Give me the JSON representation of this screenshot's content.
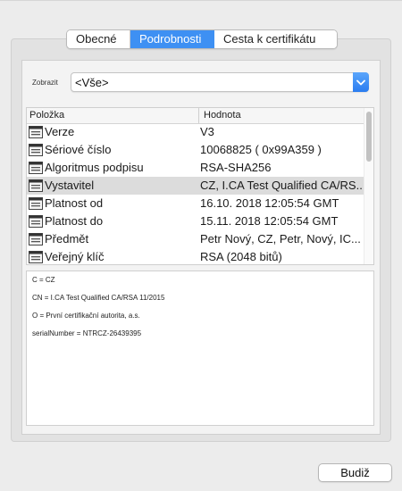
{
  "tabs": [
    {
      "label": "Obecné",
      "active": false
    },
    {
      "label": "Podrobnosti",
      "active": true
    },
    {
      "label": "Cesta k certifikátu",
      "active": false
    }
  ],
  "show": {
    "label": "Zobrazit",
    "value": "<Vše>"
  },
  "table": {
    "headers": {
      "field": "Položka",
      "value": "Hodnota"
    },
    "rows": [
      {
        "field": "Verze",
        "value": "V3"
      },
      {
        "field": "Sériové číslo",
        "value": "10068825 ( 0x99A359 )"
      },
      {
        "field": "Algoritmus podpisu",
        "value": "RSA-SHA256"
      },
      {
        "field": "Vystavitel",
        "value": "CZ, I.CA Test Qualified CA/RS..."
      },
      {
        "field": "Platnost od",
        "value": "16.10. 2018 12:05:54 GMT"
      },
      {
        "field": "Platnost do",
        "value": "15.11. 2018 12:05:54 GMT"
      },
      {
        "field": "Předmět",
        "value": "Petr Nový, CZ, Petr, Nový, IC..."
      },
      {
        "field": "Veřejný klíč",
        "value": "RSA (2048 bitů)"
      }
    ],
    "selected_row": "Vystavitel"
  },
  "detail_lines": [
    "C = CZ",
    "CN = I.CA Test Qualified CA/RSA 11/2015",
    "O = První certifikační autorita, a.s.",
    "serialNumber = NTRCZ-26439395"
  ],
  "buttons": {
    "ok": "Budiž"
  },
  "colors": {
    "accent": "#3e90f3",
    "selection": "#dcdcdc"
  }
}
